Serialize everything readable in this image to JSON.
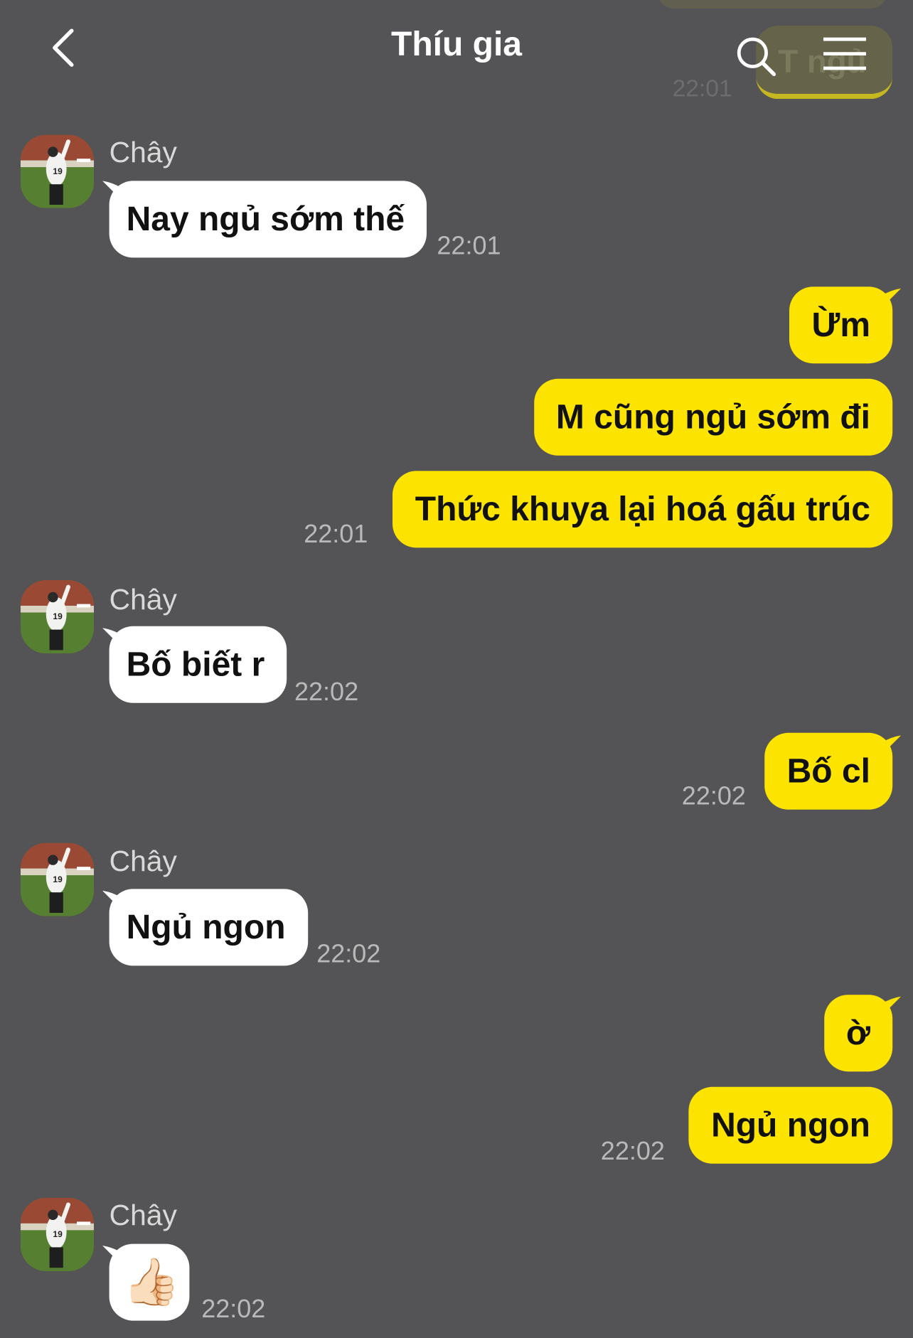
{
  "header": {
    "title": "Thíu gia",
    "ghost_text": "T ngủ",
    "ghost_time": "22:01"
  },
  "messages": [
    {
      "sender": "Chây",
      "text": "Nay ngủ sớm thế",
      "time": "22:01"
    },
    {
      "text": "Ừm"
    },
    {
      "text": "M cũng ngủ sớm đi"
    },
    {
      "text": "Thức khuya lại hoá gấu trúc",
      "time": "22:01"
    },
    {
      "sender": "Chây",
      "text": "Bố biết r",
      "time": "22:02"
    },
    {
      "text": "Bố cl",
      "time": "22:02"
    },
    {
      "sender": "Chây",
      "text": "Ngủ ngon",
      "time": "22:02"
    },
    {
      "text": "ờ"
    },
    {
      "text": "Ngủ ngon",
      "time": "22:02"
    },
    {
      "sender": "Chây",
      "text": "👍🏻",
      "time": "22:02"
    }
  ],
  "colors": {
    "background": "#545355",
    "outgoing_bubble": "#fce300",
    "incoming_bubble": "#ffffff"
  }
}
